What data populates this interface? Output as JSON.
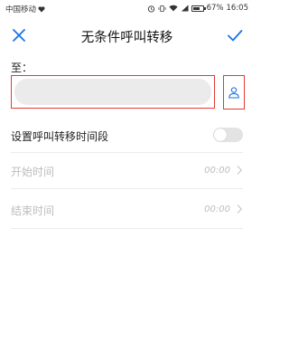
{
  "status_bar": {
    "carrier": "中国移动",
    "battery": "67%",
    "battery_level": 0.67,
    "time": "16:05"
  },
  "header": {
    "title": "无条件呼叫转移",
    "close_icon": "close-icon",
    "confirm_icon": "check-icon",
    "accent_color": "#1a73e8"
  },
  "form": {
    "to_label": "至：",
    "number_value": "",
    "number_placeholder": "",
    "contact_icon": "contact-icon",
    "highlight_color": "#e53935"
  },
  "settings": {
    "time_period_label": "设置呼叫转移时间段",
    "time_period_enabled": false,
    "start_label": "开始时间",
    "start_value": "00:00",
    "end_label": "结束时间",
    "end_value": "00:00"
  }
}
